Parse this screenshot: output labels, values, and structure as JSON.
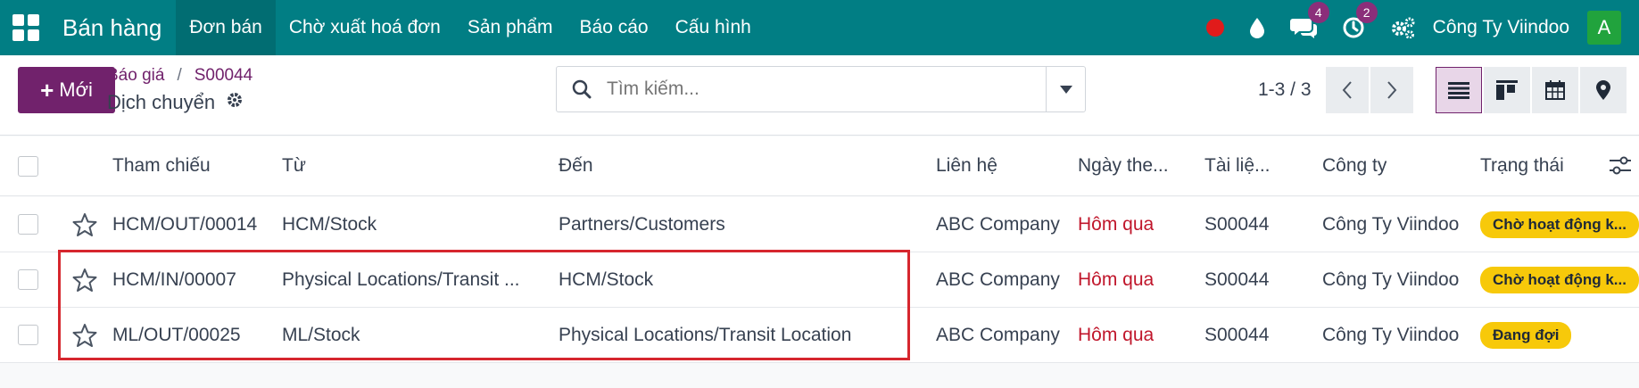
{
  "navbar": {
    "app_name": "Bán hàng",
    "menu": [
      "Đơn bán",
      "Chờ xuất hoá đơn",
      "Sản phẩm",
      "Báo cáo",
      "Cấu hình"
    ],
    "chat_badge": "4",
    "activity_badge": "2",
    "company": "Công Ty Viindoo",
    "avatar_letter": "A"
  },
  "control_panel": {
    "new_label": "Mới",
    "breadcrumb": [
      "Báo giá",
      "S00044"
    ],
    "title": "Dịch chuyển",
    "search_placeholder": "Tìm kiếm...",
    "pager": "1-3 / 3"
  },
  "table": {
    "columns": [
      "Tham chiếu",
      "Từ",
      "Đến",
      "Liên hệ",
      "Ngày the...",
      "Tài liệ...",
      "Công ty",
      "Trạng thái"
    ],
    "rows": [
      {
        "ref": "HCM/OUT/00014",
        "from": "HCM/Stock",
        "to": "Partners/Customers",
        "contact": "ABC Company",
        "date": "Hôm qua",
        "doc": "S00044",
        "company": "Công Ty Viindoo",
        "status": "Chờ hoạt động k..."
      },
      {
        "ref": "HCM/IN/00007",
        "from": "Physical Locations/Transit ...",
        "to": "HCM/Stock",
        "contact": "ABC Company",
        "date": "Hôm qua",
        "doc": "S00044",
        "company": "Công Ty Viindoo",
        "status": "Chờ hoạt động k..."
      },
      {
        "ref": "ML/OUT/00025",
        "from": "ML/Stock",
        "to": "Physical Locations/Transit Location",
        "contact": "ABC Company",
        "date": "Hôm qua",
        "doc": "S00044",
        "company": "Công Ty Viindoo",
        "status": "Đang đợi"
      }
    ]
  },
  "colors": {
    "navbar": "#017e84",
    "primary": "#71226c",
    "late": "#c0162b",
    "status_badge": "#f7c90a",
    "highlight": "#d6262e"
  }
}
